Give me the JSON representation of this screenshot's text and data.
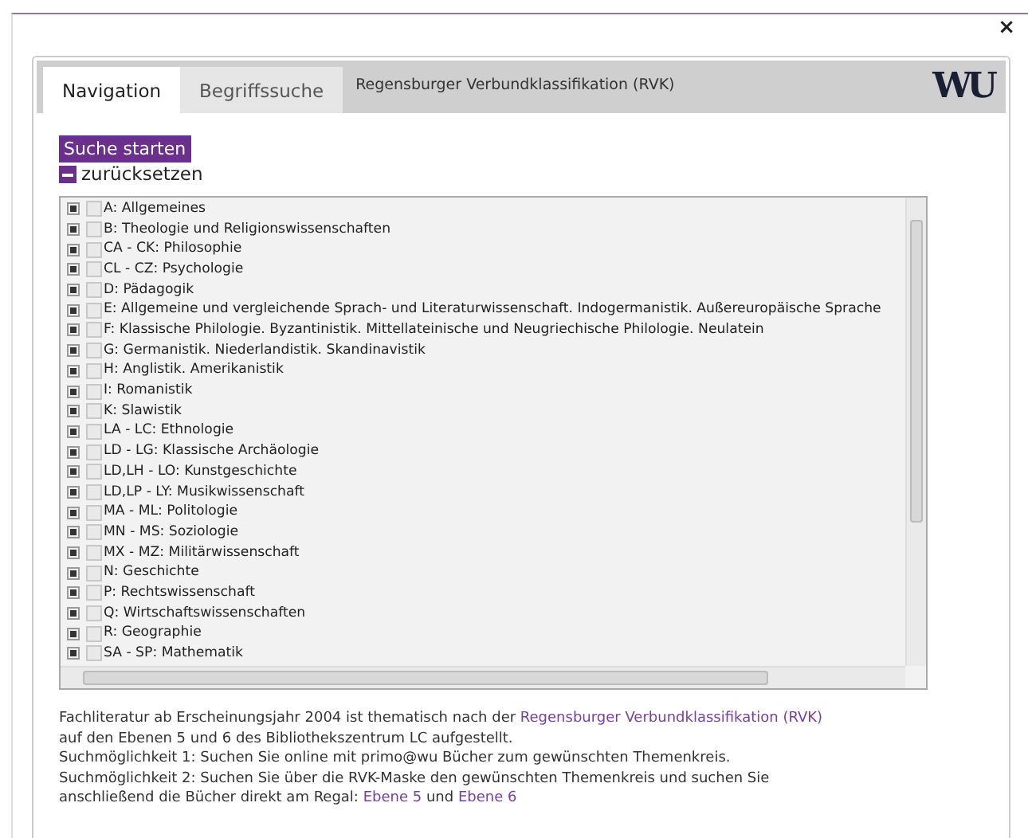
{
  "dialog": {
    "close": "×"
  },
  "tabs": [
    {
      "label": "Navigation",
      "selected": true
    },
    {
      "label": "Begriffssuche",
      "selected": false
    }
  ],
  "header_title": "Regensburger Verbundklassifikation (RVK)",
  "logo": "WU",
  "search_button": "Suche starten",
  "reset_button": "zurücksetzen",
  "tree": [
    {
      "label": "A: Allgemeines",
      "expanded": false,
      "checked": false
    },
    {
      "label": "B: Theologie und Religionswissenschaften",
      "expanded": false,
      "checked": false
    },
    {
      "label": "CA - CK: Philosophie",
      "expanded": false,
      "checked": false
    },
    {
      "label": "CL - CZ: Psychologie",
      "expanded": false,
      "checked": false
    },
    {
      "label": "D: Pädagogik",
      "expanded": false,
      "checked": false
    },
    {
      "label": "E: Allgemeine und vergleichende Sprach- und Literaturwissenschaft. Indogermanistik. Außereuropäische Sprache",
      "expanded": false,
      "checked": false
    },
    {
      "label": "F: Klassische Philologie. Byzantinistik. Mittellateinische und Neugriechische Philologie. Neulatein",
      "expanded": false,
      "checked": false
    },
    {
      "label": "G: Germanistik. Niederlandistik. Skandinavistik",
      "expanded": false,
      "checked": false
    },
    {
      "label": "H: Anglistik. Amerikanistik",
      "expanded": false,
      "checked": false
    },
    {
      "label": "I: Romanistik",
      "expanded": false,
      "checked": false
    },
    {
      "label": "K: Slawistik",
      "expanded": false,
      "checked": false
    },
    {
      "label": "LA - LC: Ethnologie",
      "expanded": false,
      "checked": false
    },
    {
      "label": "LD - LG: Klassische Archäologie",
      "expanded": false,
      "checked": false
    },
    {
      "label": "LD,LH - LO: Kunstgeschichte",
      "expanded": false,
      "checked": false
    },
    {
      "label": "LD,LP - LY: Musikwissenschaft",
      "expanded": false,
      "checked": false
    },
    {
      "label": "MA - ML: Politologie",
      "expanded": false,
      "checked": false
    },
    {
      "label": "MN - MS: Soziologie",
      "expanded": false,
      "checked": false
    },
    {
      "label": "MX - MZ: Militärwissenschaft",
      "expanded": false,
      "checked": false
    },
    {
      "label": "N: Geschichte",
      "expanded": false,
      "checked": false
    },
    {
      "label": "P: Rechtswissenschaft",
      "expanded": false,
      "checked": false
    },
    {
      "label": "Q: Wirtschaftswissenschaften",
      "expanded": false,
      "checked": false
    },
    {
      "label": "R: Geographie",
      "expanded": false,
      "checked": false
    },
    {
      "label": "SA - SP: Mathematik",
      "expanded": false,
      "checked": false
    }
  ],
  "info": [
    [
      {
        "text": "Fachliteratur ab Erscheinungsjahr 2004 ist thematisch nach der ",
        "link": false
      },
      {
        "text": "Regensburger Verbundklassifikation (RVK)",
        "link": true
      },
      {
        "text": " auf den Ebenen 5 und 6 des Bibliothekszentrum LC aufgestellt.",
        "link": false
      }
    ],
    [
      {
        "text": "Suchmöglichkeit 1: Suchen Sie online mit primo@wu Bücher zum gewünschten Themenkreis.",
        "link": false
      }
    ],
    [
      {
        "text": "Suchmöglichkeit 2: Suchen Sie über die RVK-Maske den gewünschten Themenkreis und suchen Sie anschließend die Bücher direkt am Regal: ",
        "link": false
      },
      {
        "text": "Ebene 5",
        "link": true
      },
      {
        "text": " und ",
        "link": false
      },
      {
        "text": "Ebene 6",
        "link": true
      }
    ]
  ]
}
